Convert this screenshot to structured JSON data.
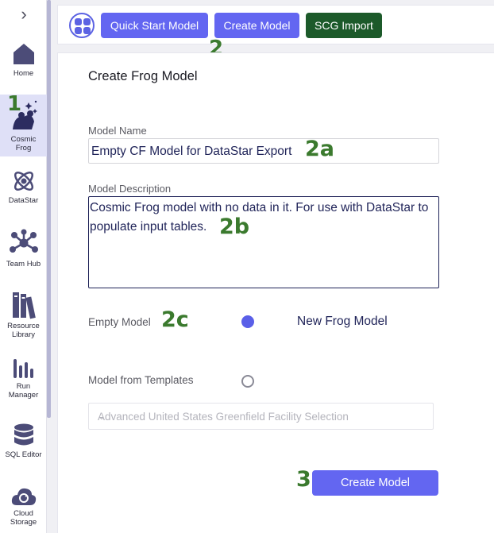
{
  "sidebar": {
    "collapse_icon": "chevron-right-icon",
    "items": [
      {
        "label": "Home",
        "icon": "home-icon"
      },
      {
        "label": "Cosmic Frog",
        "icon": "cosmic-frog-icon",
        "active": true
      },
      {
        "label": "DataStar",
        "icon": "datastar-icon"
      },
      {
        "label": "Team Hub",
        "icon": "team-hub-icon"
      },
      {
        "label": "Resource Library",
        "icon": "resource-library-icon"
      },
      {
        "label": "Run Manager",
        "icon": "run-manager-icon"
      },
      {
        "label": "SQL Editor",
        "icon": "database-icon"
      },
      {
        "label": "Cloud Storage",
        "icon": "cloud-storage-icon"
      }
    ],
    "labels": {
      "home": "Home",
      "cosmic_frog_1": "Cosmic",
      "cosmic_frog_2": "Frog",
      "datastar": "DataStar",
      "team_hub": "Team Hub",
      "resource_library_1": "Resource",
      "resource_library_2": "Library",
      "run_manager_1": "Run",
      "run_manager_2": "Manager",
      "sql_editor": "SQL Editor",
      "cloud_storage_1": "Cloud",
      "cloud_storage_2": "Storage"
    }
  },
  "toolbar": {
    "apps_icon": "apps-grid-icon",
    "quick_start_label": "Quick Start Model",
    "create_model_label": "Create Model",
    "scg_import_label": "SCG Import"
  },
  "form": {
    "title": "Create Frog Model",
    "model_name_label": "Model Name",
    "model_name_value": "Empty CF Model for DataStar Export",
    "model_description_label": "Model Description",
    "model_description_value": "Cosmic Frog model with no data in it. For use with DataStar to populate input tables.",
    "empty_model_label": "Empty Model",
    "empty_model_option": "New Frog Model",
    "templates_label": "Model from Templates",
    "template_select_value": "Advanced United States Greenfield Facility Selection",
    "create_button_label": "Create Model"
  },
  "annotations": {
    "step_1": "1",
    "step_2": "2",
    "step_2a": "2a",
    "step_2b": "2b",
    "step_2c": "2c",
    "step_3": "3"
  },
  "colors": {
    "accent": "#6366f1",
    "scg_button": "#1c5a2a",
    "annotation_green": "#3b7a2e",
    "active_nav_bg": "#dfe0f7"
  }
}
